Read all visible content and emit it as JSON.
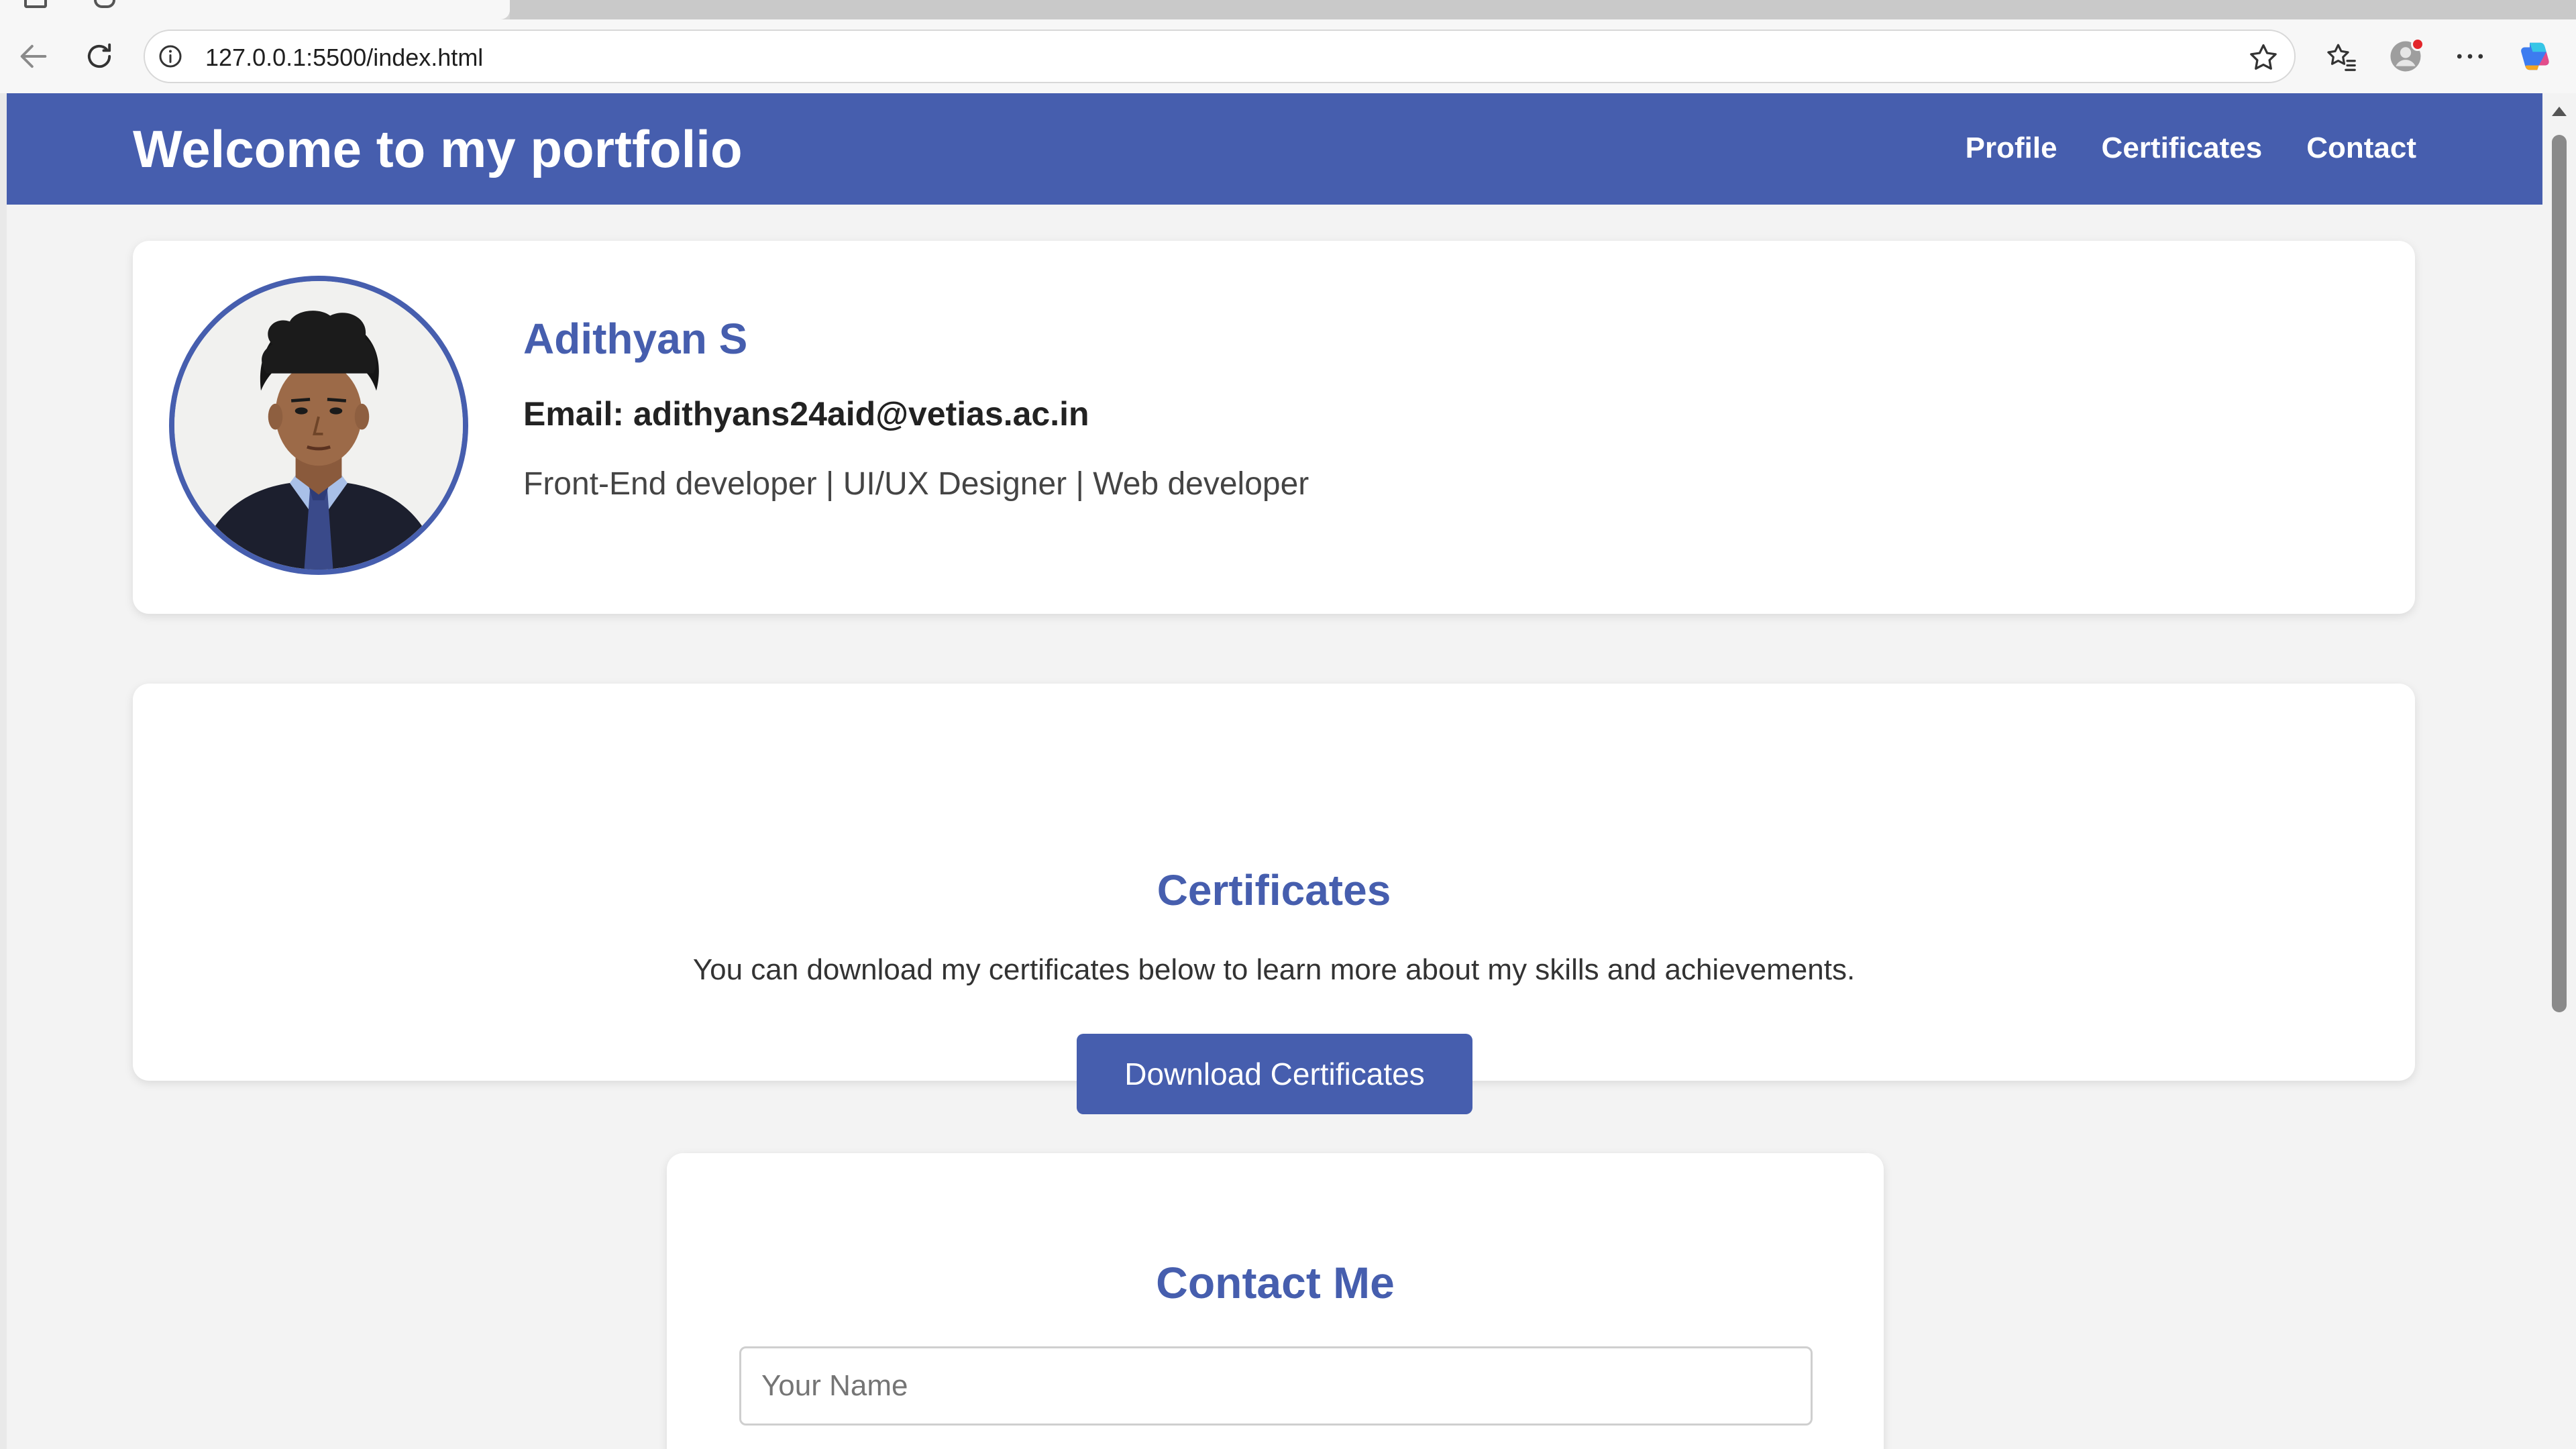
{
  "browser": {
    "url": "127.0.0.1:5500/index.html"
  },
  "header": {
    "title": "Welcome to my portfolio",
    "nav": [
      "Profile",
      "Certificates",
      "Contact"
    ]
  },
  "profile": {
    "name": "Adithyan S",
    "email": "Email: adithyans24aid@vetias.ac.in",
    "role": "Front-End developer | UI/UX Designer | Web developer"
  },
  "certificates": {
    "title": "Certificates",
    "description": "You can download my certificates below to learn more about my skills and achievements.",
    "button_label": "Download Certificates"
  },
  "contact": {
    "title": "Contact Me",
    "name_placeholder": "Your Name",
    "name_value": ""
  },
  "colors": {
    "accent": "#465eae",
    "page_background": "#f3f3f3",
    "card_background": "#ffffff",
    "notification_dot": "#e3262b"
  },
  "icons": {
    "back": "back-arrow-icon",
    "reload": "reload-icon",
    "site_info": "info-icon",
    "favorite": "star-icon",
    "favorites_bar": "favorites-icon",
    "profile": "profile-icon",
    "more": "more-icon",
    "copilot": "copilot-icon"
  }
}
